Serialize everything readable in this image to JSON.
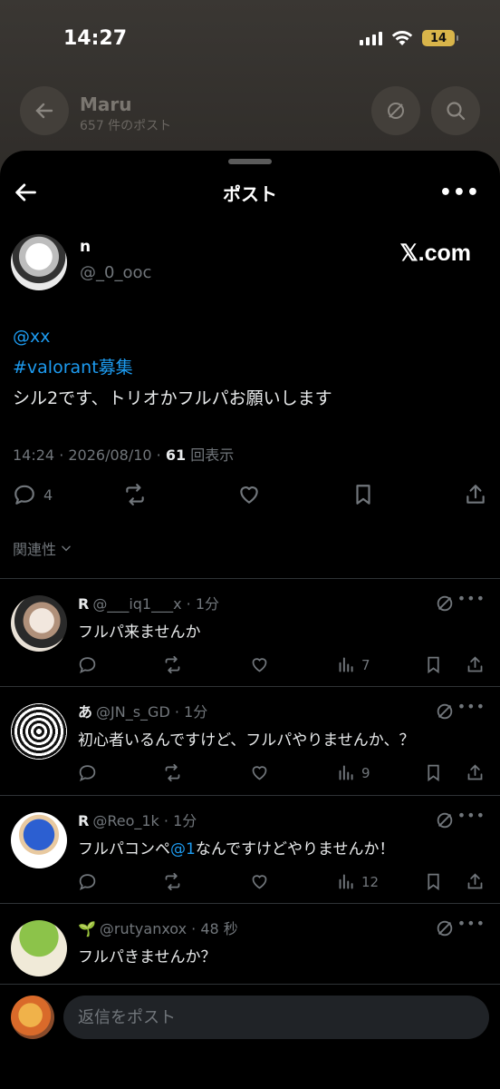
{
  "status_bar": {
    "time": "14:27",
    "battery": "14"
  },
  "background": {
    "title": "Maru",
    "subtitle": "657 件のポスト"
  },
  "nav": {
    "title": "ポスト"
  },
  "post": {
    "author_name": "n",
    "author_handle": "@_0_ooc",
    "source_label": "𝕏.com",
    "mention": "@xx",
    "hashtag": "#valorant募集",
    "body": "シル2です、トリオかフルパお願いします",
    "timestamp": "14:24 · 2026/08/10 · ",
    "views": "61",
    "views_label": " 回表示",
    "reply_count": "4",
    "sort_label": "関連性"
  },
  "replies": [
    {
      "name": "R",
      "handle": "@___iq1___x · 1分",
      "text": "フルパ来ませんか",
      "views": "7"
    },
    {
      "name": "あ",
      "handle": "@JN_s_GD · 1分",
      "text": "初心者いるんですけど、フルパやりませんか、？",
      "views": "9"
    },
    {
      "name": "R",
      "handle": "@Reo_1k · 1分",
      "text_before": "フルパコンペ",
      "text_link": "@1",
      "text_after": "なんですけどやりませんか！",
      "views": "12"
    },
    {
      "name": "🌱",
      "handle": "@rutyanxox · 48 秒",
      "text": "フルパきませんか？",
      "views": ""
    }
  ],
  "composer": {
    "placeholder": "返信をポスト"
  },
  "colors": {
    "accent": "#1d9bf0",
    "muted": "#71767b",
    "background": "#000000",
    "battery": "#d9b54a"
  }
}
